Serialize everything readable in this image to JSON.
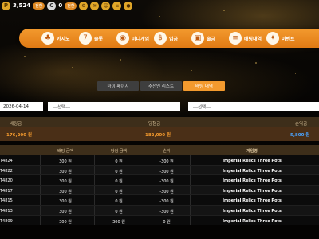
{
  "topbar": {
    "balance": "3,524",
    "balance_badge": "전환",
    "point": "0",
    "point_badge": "전환",
    "coin1": "P",
    "coin2": "C"
  },
  "nav": {
    "items": [
      {
        "label": "카지노",
        "icon": "casino-chip-icon",
        "glyph": "♣"
      },
      {
        "label": "슬롯",
        "icon": "slot-machine-icon",
        "glyph": "7"
      },
      {
        "label": "미니게임",
        "icon": "mini-game-icon",
        "glyph": "◉"
      },
      {
        "label": "입금",
        "icon": "deposit-coins-icon",
        "glyph": "$"
      },
      {
        "label": "출금",
        "icon": "withdraw-box-icon",
        "glyph": "▣"
      },
      {
        "label": "배팅내역",
        "icon": "bet-history-icon",
        "glyph": "≡"
      },
      {
        "label": "이벤트",
        "icon": "gift-icon",
        "glyph": "✦"
      }
    ]
  },
  "tabs": [
    {
      "label": "마이 페이지",
      "active": false
    },
    {
      "label": "추천인 리스트",
      "active": false
    },
    {
      "label": "배팅 내역",
      "active": true
    }
  ],
  "filters": {
    "date": "2026-04-14",
    "select1": "---선택---",
    "select2": "---선택---"
  },
  "summary": {
    "headers": [
      "배팅금",
      "당첨금",
      "손익금"
    ],
    "values": [
      "176,200 원",
      "182,000 원",
      "5,800 원"
    ]
  },
  "table": {
    "headers": [
      "",
      "배팅 금액",
      "당첨 금액",
      "손익",
      "게임명"
    ],
    "rows": [
      {
        "id": "T4824",
        "bet": "300 원",
        "win": "0 원",
        "pl": "-300 원",
        "game": "Imperial Relics Three Pots"
      },
      {
        "id": "T4822",
        "bet": "300 원",
        "win": "0 원",
        "pl": "-300 원",
        "game": "Imperial Relics Three Pots"
      },
      {
        "id": "T4820",
        "bet": "300 원",
        "win": "0 원",
        "pl": "-300 원",
        "game": "Imperial Relics Three Pots"
      },
      {
        "id": "T4817",
        "bet": "300 원",
        "win": "0 원",
        "pl": "-300 원",
        "game": "Imperial Relics Three Pots"
      },
      {
        "id": "T4815",
        "bet": "300 원",
        "win": "0 원",
        "pl": "-300 원",
        "game": "Imperial Relics Three Pots"
      },
      {
        "id": "T4813",
        "bet": "300 원",
        "win": "0 원",
        "pl": "-300 원",
        "game": "Imperial Relics Three Pots"
      },
      {
        "id": "T4809",
        "bet": "300 원",
        "win": "300 원",
        "pl": "0 원",
        "game": "Imperial Relics Three Pots"
      }
    ]
  },
  "colors": {
    "accent": "#f39a2e",
    "profit": "#4aa3ff",
    "header_bg": "#3d2e1a"
  }
}
